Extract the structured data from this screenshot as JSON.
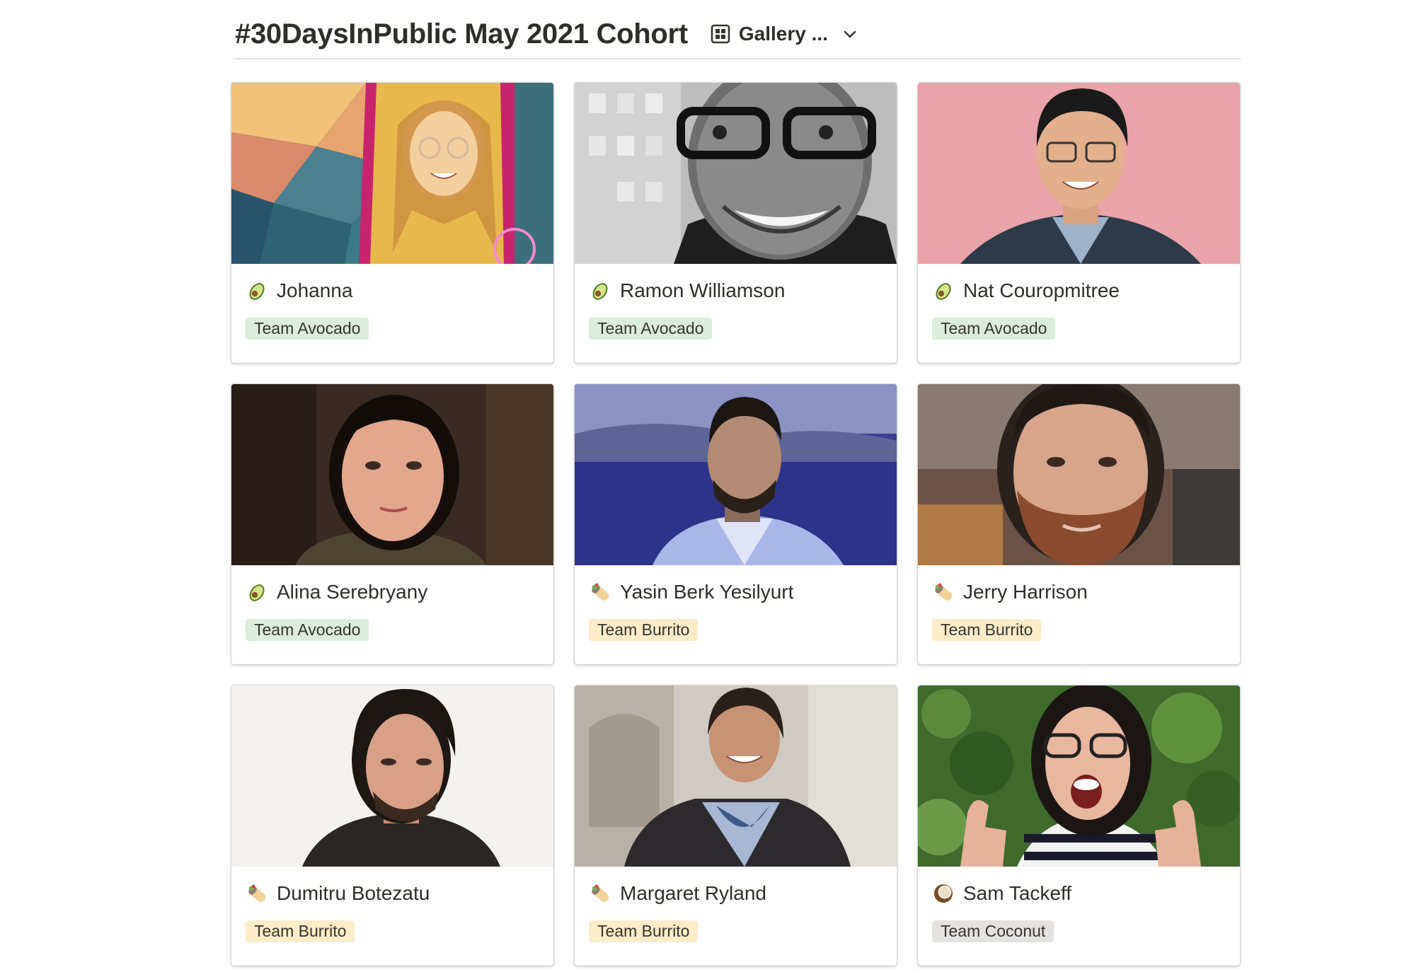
{
  "header": {
    "title": "#30DaysInPublic May 2021 Cohort",
    "view_label": "Gallery ...",
    "view_icon": "gallery-grid-icon",
    "dropdown_icon": "chevron-down-icon"
  },
  "tag_colors": {
    "Team Avocado": "#dbeddb",
    "Team Burrito": "#fdecc8",
    "Team Coconut": "#e3e2e0"
  },
  "cards": [
    {
      "name": "Johanna",
      "emoji": "avocado-icon",
      "tag": "Team Avocado",
      "cover": "cover-johanna"
    },
    {
      "name": "Ramon Williamson",
      "emoji": "avocado-icon",
      "tag": "Team Avocado",
      "cover": "cover-ramon"
    },
    {
      "name": "Nat Couropmitree",
      "emoji": "avocado-icon",
      "tag": "Team Avocado",
      "cover": "cover-nat"
    },
    {
      "name": "Alina Serebryany",
      "emoji": "avocado-icon",
      "tag": "Team Avocado",
      "cover": "cover-alina"
    },
    {
      "name": "Yasin Berk Yesilyurt",
      "emoji": "burrito-icon",
      "tag": "Team Burrito",
      "cover": "cover-yasin"
    },
    {
      "name": "Jerry Harrison",
      "emoji": "burrito-icon",
      "tag": "Team Burrito",
      "cover": "cover-jerry"
    },
    {
      "name": "Dumitru Botezatu",
      "emoji": "burrito-icon",
      "tag": "Team Burrito",
      "cover": "cover-dumitru"
    },
    {
      "name": "Margaret Ryland",
      "emoji": "burrito-icon",
      "tag": "Team Burrito",
      "cover": "cover-margaret"
    },
    {
      "name": "Sam Tackeff",
      "emoji": "coconut-icon",
      "tag": "Team Coconut",
      "cover": "cover-sam"
    }
  ]
}
